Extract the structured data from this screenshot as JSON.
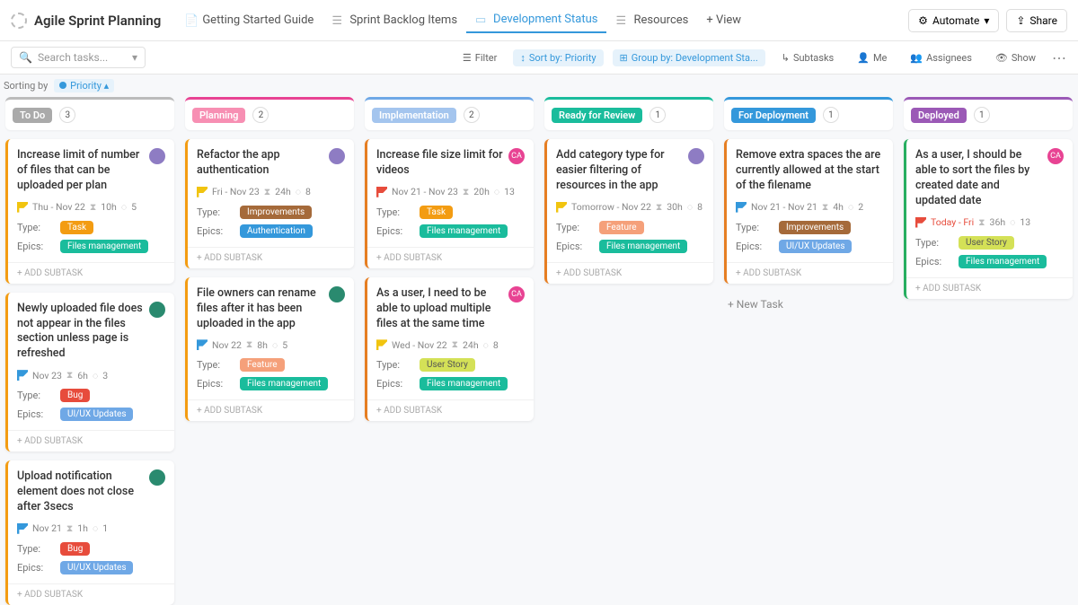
{
  "header": {
    "title": "Agile Sprint Planning",
    "tabs": [
      {
        "label": "Getting Started Guide"
      },
      {
        "label": "Sprint Backlog Items"
      },
      {
        "label": "Development Status",
        "active": true
      },
      {
        "label": "Resources"
      },
      {
        "label": "+ View"
      }
    ],
    "automate": "Automate",
    "share": "Share"
  },
  "subbar": {
    "search_placeholder": "Search tasks...",
    "filter": "Filter",
    "sort": "Sort by: Priority",
    "group": "Group by: Development Sta...",
    "subtasks": "Subtasks",
    "me": "Me",
    "assignees": "Assignees",
    "show": "Show"
  },
  "sortline": {
    "prefix": "Sorting by",
    "chip": "Priority ▴"
  },
  "columns": [
    {
      "name": "To Do",
      "count": 3,
      "stripe": "#bbb",
      "label_bg": "#aaa",
      "cardColor": "#f39c12",
      "cards": [
        {
          "title": "Increase limit of number of files that can be uploaded per plan",
          "avatar": "av-purple",
          "flag": "yellow",
          "date": "Thu  -  Nov 22",
          "hours": "10h",
          "sub": "5",
          "type": "Task",
          "typeClass": "task",
          "epic": "Files management",
          "epicClass": "files"
        },
        {
          "title": "Newly uploaded file does not appear in the files section unless page is refreshed",
          "avatar": "av-green",
          "flag": "blue",
          "date": "Nov 23",
          "hours": "6h",
          "sub": "3",
          "type": "Bug",
          "typeClass": "bug",
          "epic": "UI/UX Updates",
          "epicClass": "uiux"
        },
        {
          "title": "Upload notification element does not close after 3secs",
          "avatar": "av-green",
          "flag": "blue",
          "date": "Nov 21",
          "hours": "1h",
          "sub": "1",
          "type": "Bug",
          "typeClass": "bug",
          "epic": "UI/UX Updates",
          "epicClass": "uiux"
        }
      ]
    },
    {
      "name": "Planning",
      "count": 2,
      "stripe": "#e84393",
      "label_bg": "#f78fb3",
      "cardColor": "#f39c12",
      "cards": [
        {
          "title": "Refactor the app authentication",
          "avatar": "av-purple",
          "flag": "yellow",
          "date": "Fri  -  Nov 23",
          "hours": "24h",
          "sub": "8",
          "type": "Improvements",
          "typeClass": "improve",
          "epic": "Authentication",
          "epicClass": "auth"
        },
        {
          "title": "File owners can rename files after it has been uploaded in the app",
          "avatar": "av-green",
          "flag": "blue",
          "date": "Nov 22",
          "hours": "8h",
          "sub": "5",
          "type": "Feature",
          "typeClass": "feature",
          "epic": "Files management",
          "epicClass": "files"
        }
      ]
    },
    {
      "name": "Implementation",
      "count": 2,
      "stripe": "#6fa8e6",
      "label_bg": "#a4c5ee",
      "cardColor": "#e67e22",
      "cards": [
        {
          "title": "Increase file size limit for videos",
          "avatar": "av-pink",
          "avText": "CA",
          "flag": "red",
          "date": "Nov 21  -  Nov 23",
          "hours": "20h",
          "sub": "13",
          "type": "Task",
          "typeClass": "task",
          "epic": "Files management",
          "epicClass": "files"
        },
        {
          "title": "As a user, I need to be able to upload multiple files at the same time",
          "avatar": "av-pink",
          "avText": "CA",
          "flag": "yellow",
          "date": "Wed  -  Nov 22",
          "hours": "24h",
          "sub": "8",
          "type": "User Story",
          "typeClass": "story",
          "epic": "Files management",
          "epicClass": "files"
        }
      ]
    },
    {
      "name": "Ready for Review",
      "count": 1,
      "stripe": "#1abc9c",
      "label_bg": "#1abc9c",
      "cardColor": "#e67e22",
      "cards": [
        {
          "title": "Add category type for easier filtering of resources in the app",
          "avatar": "av-purple",
          "flag": "yellow",
          "date": "Tomorrow  -  Nov 22",
          "hours": "30h",
          "sub": "8",
          "type": "Feature",
          "typeClass": "feature",
          "epic": "Files management",
          "epicClass": "files"
        }
      ]
    },
    {
      "name": "For Deployment",
      "count": 1,
      "stripe": "#3498db",
      "label_bg": "#3498db",
      "cardColor": "#e67e22",
      "newTask": "+ New Task",
      "cards": [
        {
          "title": "Remove extra spaces the are currently allowed at the start of the filename",
          "flag": "blue",
          "date": "Nov 21  -  Nov 21",
          "hours": "4h",
          "sub": "2",
          "type": "Improvements",
          "typeClass": "improve",
          "epic": "UI/UX Updates",
          "epicClass": "uiux"
        }
      ]
    },
    {
      "name": "Deployed",
      "count": 1,
      "stripe": "#9b59b6",
      "label_bg": "#9b59b6",
      "cardColor": "#27ae60",
      "cards": [
        {
          "title": "As a user, I should be able to sort the files by created date and updated date",
          "avatar": "av-pink",
          "avText": "CA",
          "flag": "red",
          "date": "Today  -  Fri",
          "hours": "36h",
          "sub": "13",
          "type": "User Story",
          "typeClass": "story",
          "epic": "Files management",
          "epicClass": "files",
          "dateRed": true
        }
      ]
    }
  ],
  "labels": {
    "type": "Type:",
    "epics": "Epics:",
    "addSubtask": "+ ADD SUBTASK"
  }
}
